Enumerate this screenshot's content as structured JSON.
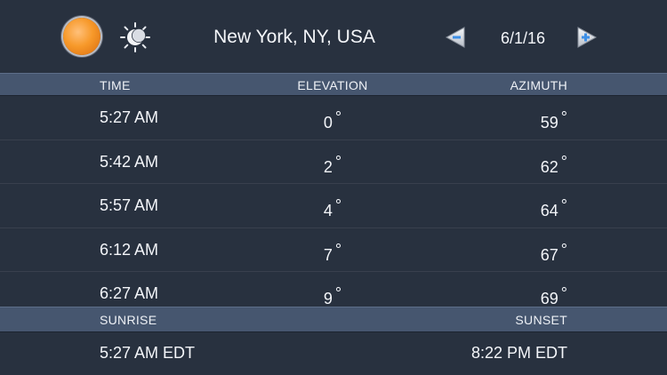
{
  "header": {
    "sun_icon": "sun-icon",
    "moon_icon": "sun-moon-icon",
    "location": "New York, NY, USA",
    "date": "6/1/16",
    "prev_icon": "left-arrow-icon",
    "next_icon": "right-arrow-icon"
  },
  "table": {
    "columns": [
      "TIME",
      "ELEVATION",
      "AZIMUTH"
    ],
    "degree_symbol": "°",
    "rows": [
      {
        "time": "5:27 AM",
        "elevation": "0",
        "azimuth": "59"
      },
      {
        "time": "5:42 AM",
        "elevation": "2",
        "azimuth": "62"
      },
      {
        "time": "5:57 AM",
        "elevation": "4",
        "azimuth": "64"
      },
      {
        "time": "6:12 AM",
        "elevation": "7",
        "azimuth": "67"
      },
      {
        "time": "6:27 AM",
        "elevation": "9",
        "azimuth": "69"
      }
    ]
  },
  "footer": {
    "sunrise_label": "SUNRISE",
    "sunset_label": "SUNSET",
    "sunrise_value": "5:27 AM EDT",
    "sunset_value": "8:22 PM EDT"
  },
  "colors": {
    "background": "#28313f",
    "header_bar": "#46566f",
    "sun_orange": "#f7992a",
    "arrow_blue": "#3d8fe6"
  }
}
